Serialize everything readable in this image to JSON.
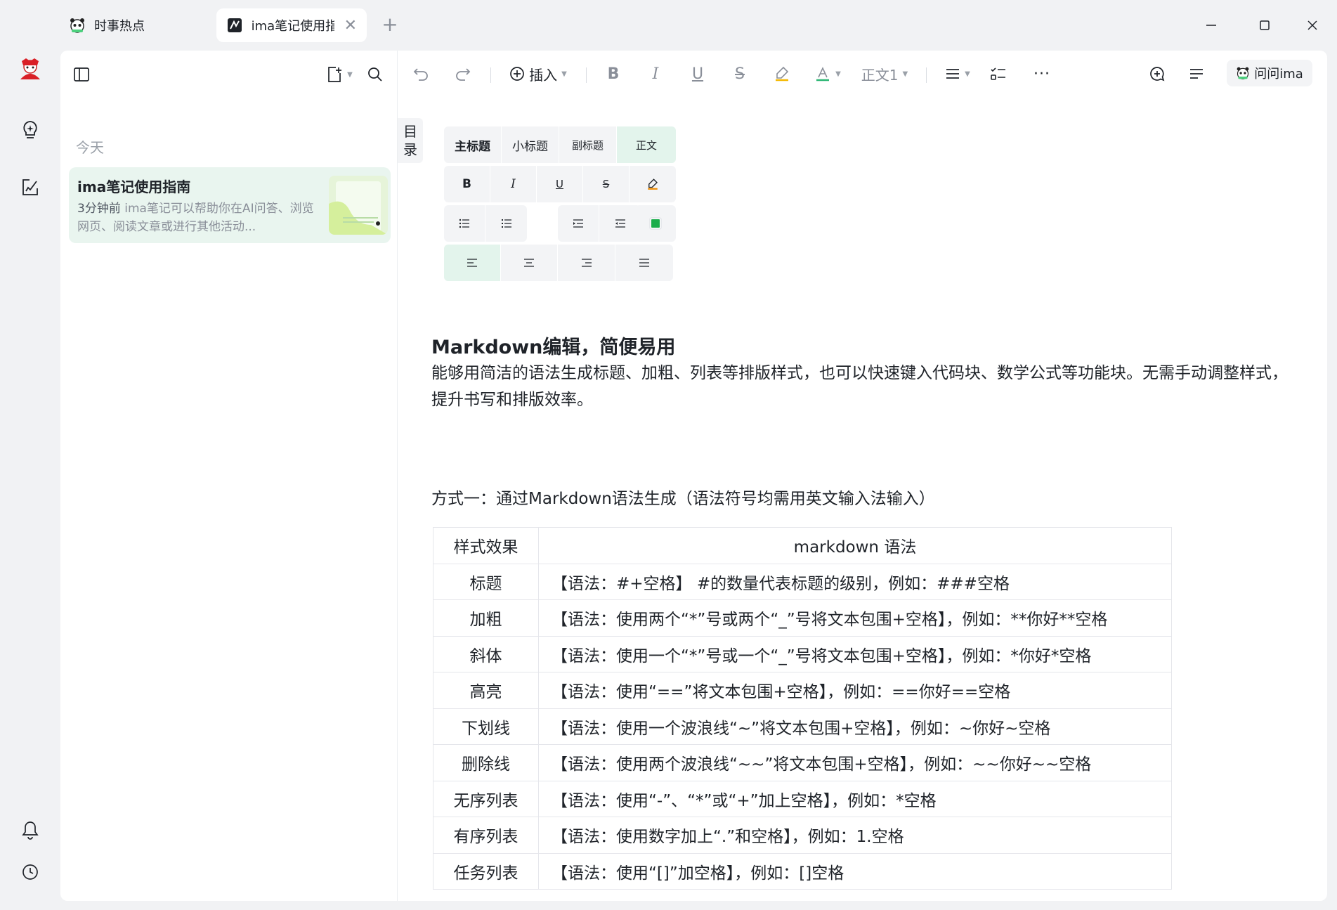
{
  "tabs": [
    {
      "label": "时事热点",
      "icon": "panda-icon"
    },
    {
      "label": "ima笔记使用指南",
      "icon": "note-app-icon"
    }
  ],
  "left_pane": {
    "section": "今天",
    "note": {
      "title": "ima笔记使用指南",
      "time": "3分钟前",
      "preview": "ima笔记可以帮助你在AI问答、浏览网页、阅读文章或进行其他活动..."
    }
  },
  "toolbar": {
    "insert_label": "插入",
    "style_label": "正文1",
    "ask_label": "问问ima"
  },
  "toc_label": "目录",
  "format_panel": {
    "headings": [
      "主标题",
      "小标题",
      "副标题",
      "正文"
    ],
    "active_heading": "正文"
  },
  "content": {
    "heading": "Markdown编辑，简便易用",
    "paragraph": "能够用简洁的语法生成标题、加粗、列表等排版样式，也可以快速键入代码块、数学公式等功能块。无需手动调整样式，提升书写和排版效率。",
    "method": "方式一：通过Markdown语法生成（语法符号均需用英文输入法输入）",
    "table": {
      "headers": [
        "样式效果",
        "markdown 语法"
      ],
      "rows": [
        [
          "标题",
          "【语法：#+空格】 #的数量代表标题的级别，例如：###空格"
        ],
        [
          "加粗",
          "【语法：使用两个“*”号或两个“_”号将文本包围+空格】，例如：**你好**空格"
        ],
        [
          "斜体",
          "【语法：使用一个“*”号或一个“_”号将文本包围+空格】，例如：*你好*空格"
        ],
        [
          "高亮",
          "【语法：使用“==”将文本包围+空格】，例如：==你好==空格"
        ],
        [
          "下划线",
          "【语法：使用一个波浪线“~”将文本包围+空格】，例如：~你好~空格"
        ],
        [
          "删除线",
          "【语法：使用两个波浪线“~~”将文本包围+空格】，例如：~~你好~~空格"
        ],
        [
          "无序列表",
          "【语法：使用“-”、“*”或“+”加上空格】，例如：*空格"
        ],
        [
          "有序列表",
          "【语法：使用数字加上“.”和空格】，例如：1.空格"
        ],
        [
          "任务列表",
          "【语法：使用“[]”加空格】，例如：[]空格"
        ]
      ]
    }
  },
  "colors": {
    "accent_green": "#e9f5ef",
    "panel_bg": "#ffffff",
    "window_bg": "#f1f2f4"
  }
}
